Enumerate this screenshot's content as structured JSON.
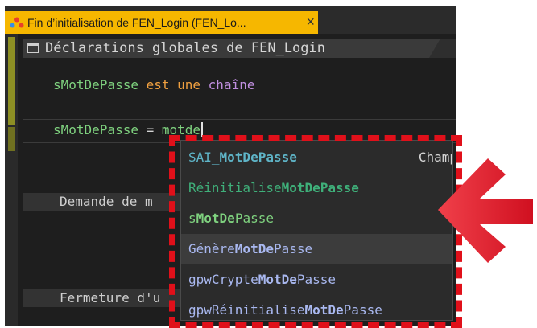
{
  "tab": {
    "title": "Fin d’initialisation de FEN_Login (FEN_Lo...",
    "close_glyph": "×",
    "icon": "windev-app-icon"
  },
  "section": {
    "title": "Déclarations globales de FEN_Login",
    "icon": "window-icon"
  },
  "code": {
    "line1": {
      "ident": "sMotDePasse",
      "kw1": " est une ",
      "type": "chaîne"
    },
    "line2": {
      "ident": "sMotDePasse",
      "op": " = ",
      "typed": "motde"
    }
  },
  "events": [
    {
      "label": "Demande de m"
    },
    {
      "label": "Fermeture d'u"
    }
  ],
  "autocomplete": {
    "items": [
      {
        "pre": "SAI_",
        "match": "MotDePasse",
        "post": "",
        "color": "#5fb5c8",
        "aside": "Champ"
      },
      {
        "pre": "Réinitialise",
        "match": "MotDePasse",
        "post": "",
        "color": "#3fb07a"
      },
      {
        "pre": "s",
        "match": "MotDe",
        "post": "Passe",
        "color": "#7fd27f"
      },
      {
        "pre": "Génère",
        "match": "MotDe",
        "post": "Passe",
        "color": "#a9b8f0",
        "selected": true
      },
      {
        "pre": "gpwCrypte",
        "match": "MotDe",
        "post": "Passe",
        "color": "#a9b8f0"
      },
      {
        "pre": "gpwRéinitialise",
        "match": "MotDe",
        "post": "Passe",
        "color": "#a9b8f0"
      }
    ]
  },
  "annotation": {
    "color": "#e0101a"
  }
}
